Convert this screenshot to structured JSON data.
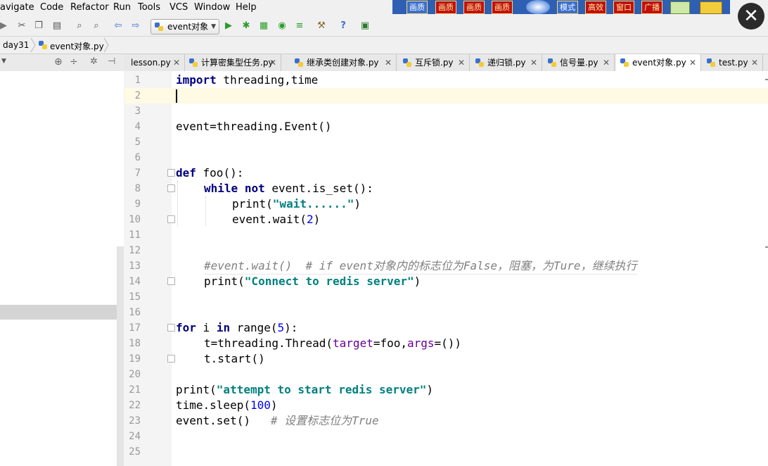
{
  "menu": [
    "avigate",
    "Code",
    "Refactor",
    "Run",
    "Tools",
    "VCS",
    "Window",
    "Help"
  ],
  "promo": [
    "画质",
    "画质",
    "画质",
    "画质",
    "模式",
    "高效",
    "窗口",
    "广播"
  ],
  "run_config": "event对象",
  "breadcrumb": [
    "day31",
    "event对象.py"
  ],
  "tabs": [
    {
      "label": "lesson.py",
      "active": false
    },
    {
      "label": "计算密集型任务.py",
      "active": false
    },
    {
      "label": "继承类创建对象.py",
      "active": false
    },
    {
      "label": "互斥锁.py",
      "active": false
    },
    {
      "label": "递归锁.py",
      "active": false
    },
    {
      "label": "信号量.py",
      "active": false
    },
    {
      "label": "event对象.py",
      "active": true
    },
    {
      "label": "test.py",
      "active": false
    }
  ],
  "line_numbers": [
    "1",
    "2",
    "3",
    "4",
    "5",
    "6",
    "7",
    "8",
    "9",
    "10",
    "11",
    "12",
    "13",
    "14",
    "15",
    "16",
    "17",
    "18",
    "19",
    "20",
    "21",
    "22",
    "23",
    "24",
    "25"
  ],
  "code": {
    "l1_kw": "import",
    "l1_rest": " threading,time",
    "l4": "event=threading.Event()",
    "l7_kw": "def",
    "l7_rest": " foo():",
    "l8_kw1": "while",
    "l8_kw2": "not",
    "l8_rest": " event.is_set():",
    "l9_a": "print(",
    "l9_str": "\"wait......\"",
    "l9_b": ")",
    "l10_a": "event.wait(",
    "l10_num": "2",
    "l10_b": ")",
    "l13_cmt": "#event.wait()  # if event对象内的标志位为False，阻塞，为Ture，继续执行",
    "l14_a": "print(",
    "l14_str": "\"Connect to redis server\"",
    "l14_b": ")",
    "l17_kw1": "for",
    "l17_i": " i ",
    "l17_kw2": "in",
    "l17_a": " range(",
    "l17_num": "5",
    "l17_b": "):",
    "l18_a": "t=threading.Thread(",
    "l18_p1": "target",
    "l18_b": "=foo,",
    "l18_p2": "args",
    "l18_c": "=())",
    "l19": "t.start()",
    "l21_a": "print(",
    "l21_str": "\"attempt to start redis server\"",
    "l21_b": ")",
    "l22_a": "time.sleep(",
    "l22_num": "100",
    "l22_b": ")",
    "l23_a": "event.set()   ",
    "l23_cmt": "# 设置标志位为True"
  },
  "colors": {
    "keyword": "#000080",
    "string": "#008080",
    "number": "#0000ff",
    "comment": "#808080",
    "param": "#660099"
  }
}
